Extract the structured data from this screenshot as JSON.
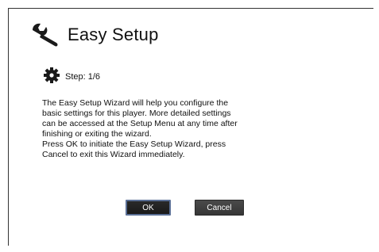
{
  "dialog": {
    "title": "Easy Setup",
    "title_icon": "wrench-icon",
    "step_icon": "gear-icon",
    "step_label": "Step: 1/6",
    "description": [
      "The Easy Setup Wizard will help you configure the",
      "basic settings for this player.  More detailed settings",
      "can be accessed at the Setup Menu at any time after",
      "finishing or exiting the wizard.",
      "Press OK to initiate the Easy Setup Wizard, press",
      "Cancel to exit this Wizard immediately."
    ],
    "ok_label": "OK",
    "cancel_label": "Cancel",
    "focused_button": "OK"
  },
  "colors": {
    "focus_border": "#5a6f95",
    "button_fill": "#2a2a2a",
    "icon": "#1a1a1a"
  }
}
